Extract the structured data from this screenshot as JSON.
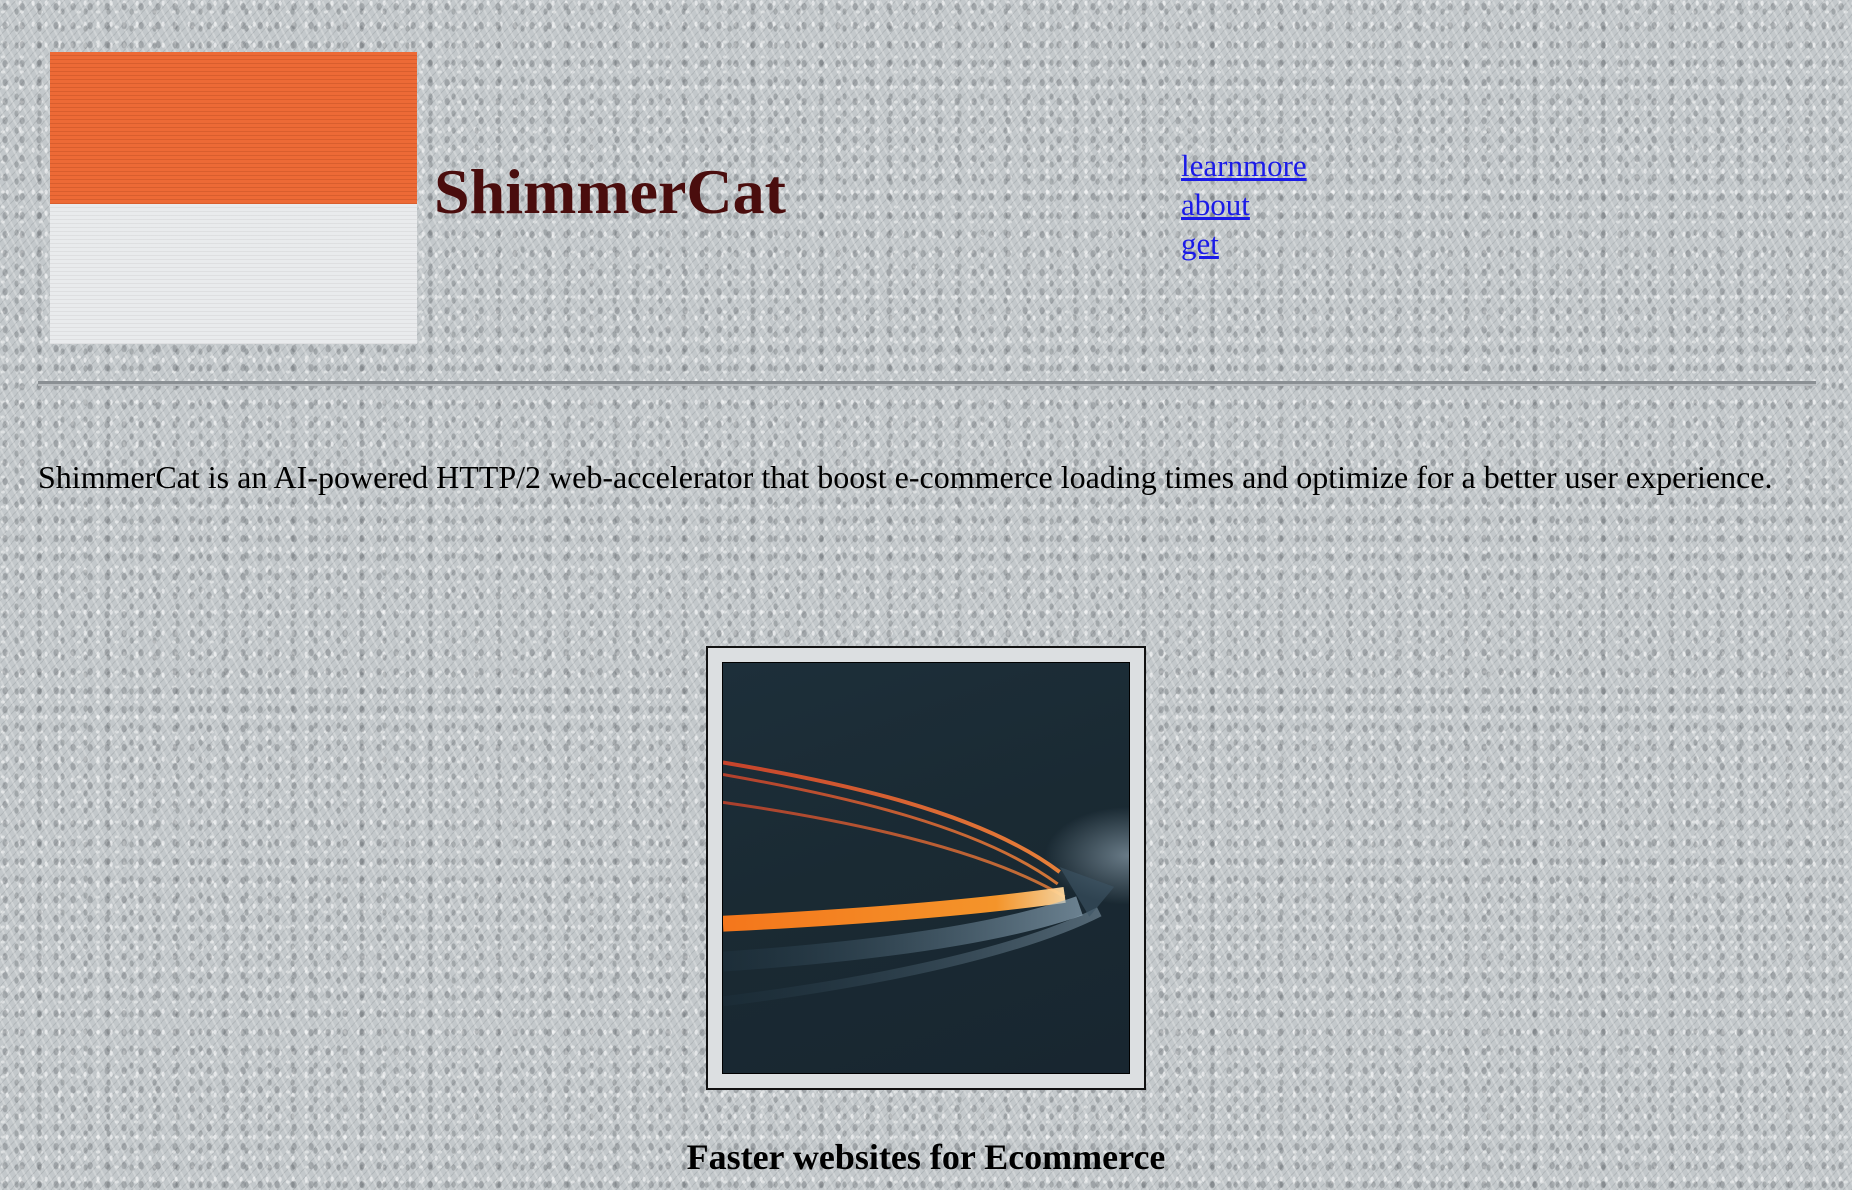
{
  "header": {
    "title": "ShimmerCat",
    "nav": [
      {
        "label": "learnmore"
      },
      {
        "label": "about"
      },
      {
        "label": "get"
      }
    ]
  },
  "intro": {
    "text": "ShimmerCat is an AI-powered HTTP/2 web-accelerator that boost e-commerce loading times and optimize for a better user experience."
  },
  "hero": {
    "image_subject": "light-trails-at-night",
    "caption": "Faster websites for Ecommerce"
  },
  "colors": {
    "flag_top": "#ed6a36",
    "flag_bottom": "#e9ebed",
    "title": "#4a0d0d",
    "link": "#1a1ae8",
    "background": "#c3c8cb"
  }
}
